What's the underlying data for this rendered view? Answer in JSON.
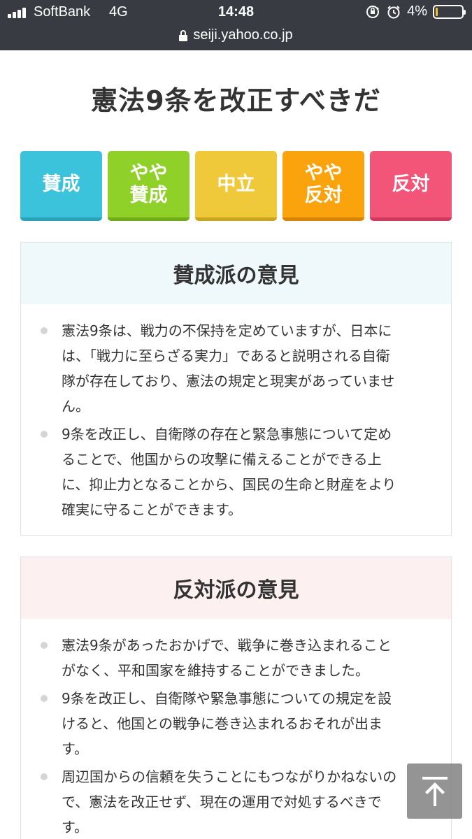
{
  "status_bar": {
    "carrier": "SoftBank",
    "network": "4G",
    "time": "14:48",
    "battery_percent": "4%",
    "battery_level": 0.04,
    "icons": [
      "signal-icon",
      "orientation-lock-icon",
      "alarm-icon",
      "battery-icon"
    ]
  },
  "browser": {
    "url": "seiji.yahoo.co.jp",
    "icons": [
      "lock-icon"
    ]
  },
  "page": {
    "title": "憲法9条を改正すべきだ"
  },
  "choices": [
    {
      "label": "賛成",
      "color": "#3bc3dc"
    },
    {
      "label": "やや\n賛成",
      "color": "#8fd129"
    },
    {
      "label": "中立",
      "color": "#f0c93a"
    },
    {
      "label": "やや\n反対",
      "color": "#fba30c"
    },
    {
      "label": "反対",
      "color": "#f25577"
    }
  ],
  "pro": {
    "heading": "賛成派の意見",
    "lines": [
      [
        "憲法9条は、戦力の不保持を定めていますが、日本に",
        "は、「戦力に至らざる実力」であると説明される自衛",
        "隊が存在しており、憲法の規定と現実があっていませ",
        "ん。"
      ],
      [
        "9条を改正し、自衛隊の存在と緊急事態について定め",
        "ることで、他国からの攻撃に備えることができる上",
        "に、抑止力となることから、国民の生命と財産をより",
        "確実に守ることができます。"
      ]
    ]
  },
  "con": {
    "heading": "反対派の意見",
    "lines": [
      [
        "憲法9条があったおかげで、戦争に巻き込まれること",
        "がなく、平和国家を維持することができました。"
      ],
      [
        "9条を改正し、自衛隊や緊急事態についての規定を設",
        "けると、他国との戦争に巻き込まれるおそれが出ま",
        "す。"
      ],
      [
        "周辺国からの信頼を失うことにもつながりかねないの",
        "で、憲法を改正せず、現在の運用で対処するべきで",
        "す。"
      ]
    ]
  },
  "scroll_top": {
    "icon": "arrow-up-icon"
  }
}
